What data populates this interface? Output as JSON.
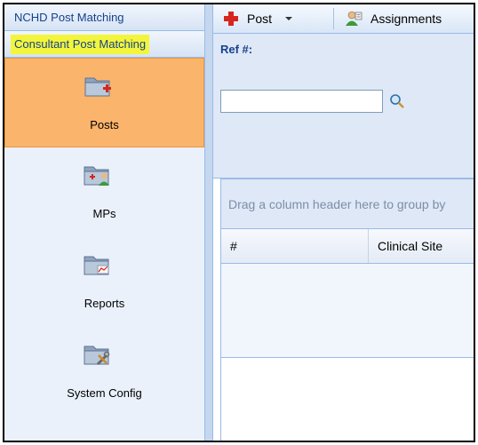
{
  "nav": {
    "headers": [
      {
        "label": "NCHD Post Matching"
      },
      {
        "label": "Consultant Post Matching"
      }
    ],
    "items": [
      {
        "label": "Posts",
        "icon": "folder-add-icon",
        "selected": true
      },
      {
        "label": "MPs",
        "icon": "folder-person-icon",
        "selected": false
      },
      {
        "label": "Reports",
        "icon": "folder-chart-icon",
        "selected": false
      },
      {
        "label": "System Config",
        "icon": "folder-tools-icon",
        "selected": false
      }
    ]
  },
  "toolbar": {
    "post_label": "Post",
    "assignments_label": "Assignments"
  },
  "form": {
    "ref_label": "Ref #:",
    "ref_value": ""
  },
  "grid": {
    "group_hint": "Drag a column header here to group by",
    "columns": [
      {
        "label": "#"
      },
      {
        "label": "Clinical Site"
      }
    ]
  },
  "colors": {
    "selected_nav": "#fbb46b",
    "highlight": "#f3f53c",
    "panel_bg": "#dfe8f6",
    "border": "#99bbe8"
  }
}
